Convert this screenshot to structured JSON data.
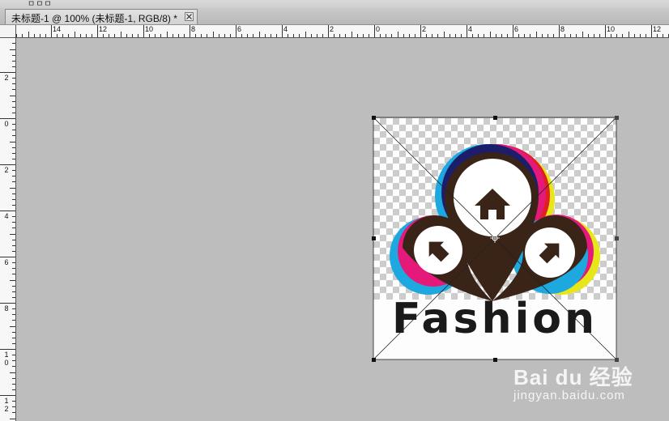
{
  "menu_strip": {
    "glyph": "ㅁㅁㅁ"
  },
  "document_tab": {
    "title": "未标题-1 @ 100% (未标题-1, RGB/8) *",
    "close_icon": "close-x-icon"
  },
  "ruler_top": {
    "labels": [
      "14",
      "12",
      "10",
      "8",
      "6",
      "4",
      "2",
      "0",
      "2",
      "4",
      "6",
      "8",
      "10",
      "12"
    ]
  },
  "ruler_left": {
    "labels": [
      "2",
      "0",
      "2",
      "4",
      "6",
      "8",
      "10",
      "12"
    ]
  },
  "canvas": {
    "background": "#bdbdbd",
    "logo_text": "Fashion",
    "logo_colors": {
      "brown": "#3a2418",
      "cyan": "#1da8e0",
      "navy": "#1b1f6b",
      "magenta": "#e4197a",
      "red": "#e02020",
      "yellow": "#e6e619"
    }
  },
  "watermark": {
    "brand": "Bai du 经验",
    "url": "jingyan.baidu.com"
  }
}
